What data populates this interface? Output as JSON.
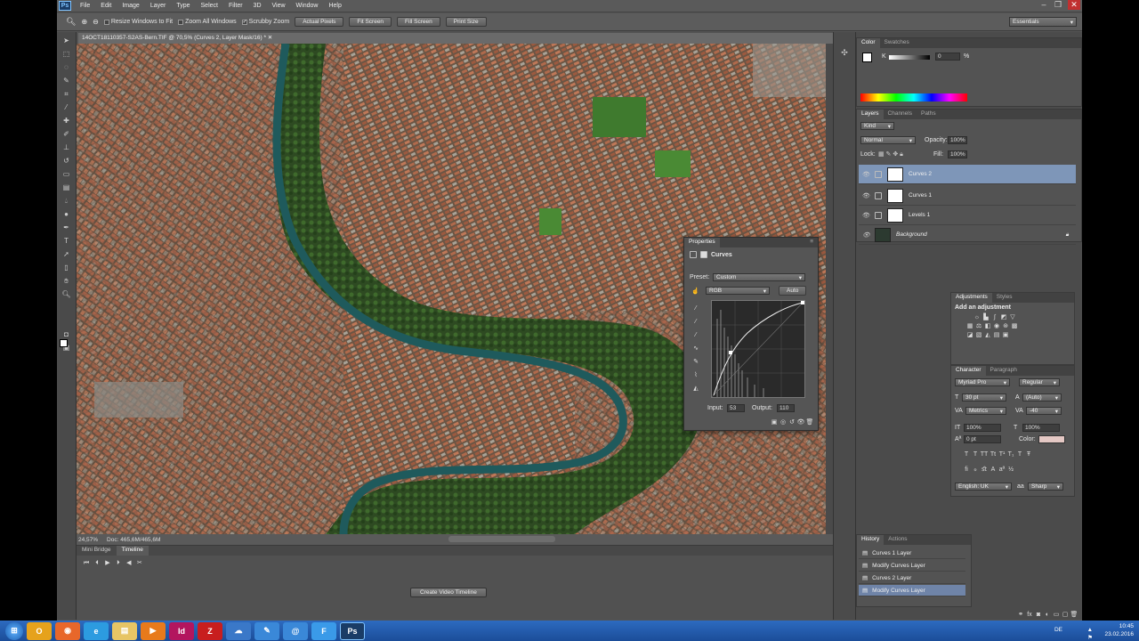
{
  "app": {
    "logo": "Ps"
  },
  "menu": [
    "File",
    "Edit",
    "Image",
    "Layer",
    "Type",
    "Select",
    "Filter",
    "3D",
    "View",
    "Window",
    "Help"
  ],
  "options": {
    "resize_windows": "Resize Windows to Fit",
    "zoom_all": "Zoom All Windows",
    "scrubby_zoom": "Scrubby Zoom",
    "actual_pixels": "Actual Pixels",
    "fit_screen": "Fit Screen",
    "fill_screen": "Fill Screen",
    "print_size": "Print Size",
    "workspace": "Essentials"
  },
  "document": {
    "tab_title": "14OCT18110357-S2AS-Bern.TIF @ 70,5% (Curves 2, Layer Mask/16) *",
    "zoom": "24,57%",
    "doc_size": "Doc: 465,6M/465,6M"
  },
  "timeline": {
    "tabs": [
      "Mini Bridge",
      "Timeline"
    ],
    "create_button": "Create Video Timeline"
  },
  "color_panel": {
    "tabs": [
      "Color",
      "Swatches"
    ],
    "k_label": "K",
    "k_value": "0",
    "unit": "%"
  },
  "layers_panel": {
    "tabs": [
      "Layers",
      "Channels",
      "Paths"
    ],
    "kind": "Kind",
    "blend_mode": "Normal",
    "opacity_label": "Opacity:",
    "opacity_value": "100%",
    "lock_label": "Lock:",
    "fill_label": "Fill:",
    "fill_value": "100%",
    "layers": [
      {
        "name": "Curves 2",
        "selected": true
      },
      {
        "name": "Curves 1",
        "selected": false
      },
      {
        "name": "Levels 1",
        "selected": false
      },
      {
        "name": "Background",
        "selected": false
      }
    ]
  },
  "properties": {
    "title": "Properties",
    "type": "Curves",
    "preset_label": "Preset:",
    "preset_value": "Custom",
    "channel": "RGB",
    "auto": "Auto",
    "input_label": "Input:",
    "input_value": "53",
    "output_label": "Output:",
    "output_value": "110"
  },
  "adjustments": {
    "tabs": [
      "Adjustments",
      "Styles"
    ],
    "heading": "Add an adjustment"
  },
  "character": {
    "tabs": [
      "Character",
      "Paragraph"
    ],
    "font": "Myriad Pro",
    "style": "Regular",
    "size": "30 pt",
    "leading": "(Auto)",
    "kerning": "Metrics",
    "tracking": "-40",
    "v_scale": "100%",
    "h_scale": "100%",
    "baseline": "0 pt",
    "color_label": "Color:",
    "language": "English: UK",
    "antialias": "Sharp"
  },
  "history": {
    "tabs": [
      "History",
      "Actions"
    ],
    "items": [
      {
        "label": "Curves 1 Layer",
        "selected": false
      },
      {
        "label": "Modify Curves Layer",
        "selected": false
      },
      {
        "label": "Curves 2 Layer",
        "selected": false
      },
      {
        "label": "Modify Curves Layer",
        "selected": true
      }
    ]
  },
  "taskbar": {
    "icons": [
      "windows-start",
      "outlook",
      "firefox",
      "ie",
      "explorer",
      "media",
      "indesign",
      "filezilla",
      "app",
      "app2",
      "outlook2",
      "files",
      "photoshop"
    ],
    "lang": "DE",
    "time": "10:45",
    "date": "23.02.2016"
  },
  "colors": {
    "selection": "#7e96b8",
    "panel": "#535353",
    "taskbar": "#2d6bc0"
  }
}
